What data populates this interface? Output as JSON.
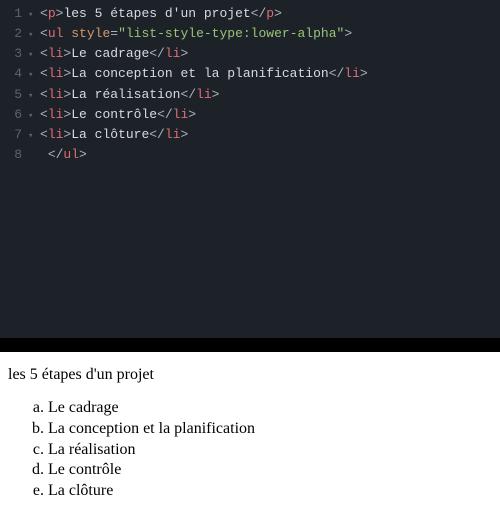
{
  "editor": {
    "lines": [
      {
        "num": "1",
        "fold": "▾",
        "tokens": [
          {
            "c": "tag-bracket",
            "t": "<"
          },
          {
            "c": "tag-name",
            "t": "p"
          },
          {
            "c": "tag-bracket",
            "t": ">"
          },
          {
            "c": "text",
            "t": "les 5 étapes d'un projet"
          },
          {
            "c": "tag-bracket",
            "t": "</"
          },
          {
            "c": "tag-name",
            "t": "p"
          },
          {
            "c": "tag-bracket",
            "t": ">"
          }
        ]
      },
      {
        "num": "2",
        "fold": "▾",
        "tokens": [
          {
            "c": "tag-bracket",
            "t": "<"
          },
          {
            "c": "tag-name",
            "t": "ul"
          },
          {
            "c": "text",
            "t": " "
          },
          {
            "c": "attr-name",
            "t": "style"
          },
          {
            "c": "attr-eq",
            "t": "="
          },
          {
            "c": "attr-value",
            "t": "\"list-style-type:lower-alpha\""
          },
          {
            "c": "tag-bracket",
            "t": ">"
          }
        ]
      },
      {
        "num": "3",
        "fold": "▾",
        "tokens": [
          {
            "c": "tag-bracket",
            "t": "<"
          },
          {
            "c": "tag-name",
            "t": "li"
          },
          {
            "c": "tag-bracket",
            "t": ">"
          },
          {
            "c": "text",
            "t": "Le cadrage"
          },
          {
            "c": "tag-bracket",
            "t": "</"
          },
          {
            "c": "tag-name",
            "t": "li"
          },
          {
            "c": "tag-bracket",
            "t": ">"
          }
        ]
      },
      {
        "num": "4",
        "fold": "▾",
        "tokens": [
          {
            "c": "tag-bracket",
            "t": "<"
          },
          {
            "c": "tag-name",
            "t": "li"
          },
          {
            "c": "tag-bracket",
            "t": ">"
          },
          {
            "c": "text",
            "t": "La conception et la planification"
          },
          {
            "c": "tag-bracket",
            "t": "</"
          },
          {
            "c": "tag-name",
            "t": "li"
          },
          {
            "c": "tag-bracket",
            "t": ">"
          }
        ]
      },
      {
        "num": "5",
        "fold": "▾",
        "tokens": [
          {
            "c": "tag-bracket",
            "t": "<"
          },
          {
            "c": "tag-name",
            "t": "li"
          },
          {
            "c": "tag-bracket",
            "t": ">"
          },
          {
            "c": "text",
            "t": "La réalisation"
          },
          {
            "c": "tag-bracket",
            "t": "</"
          },
          {
            "c": "tag-name",
            "t": "li"
          },
          {
            "c": "tag-bracket",
            "t": ">"
          }
        ]
      },
      {
        "num": "6",
        "fold": "▾",
        "tokens": [
          {
            "c": "tag-bracket",
            "t": "<"
          },
          {
            "c": "tag-name",
            "t": "li"
          },
          {
            "c": "tag-bracket",
            "t": ">"
          },
          {
            "c": "text",
            "t": "Le contrôle"
          },
          {
            "c": "tag-bracket",
            "t": "</"
          },
          {
            "c": "tag-name",
            "t": "li"
          },
          {
            "c": "tag-bracket",
            "t": ">"
          }
        ]
      },
      {
        "num": "7",
        "fold": "▾",
        "tokens": [
          {
            "c": "tag-bracket",
            "t": "<"
          },
          {
            "c": "tag-name",
            "t": "li"
          },
          {
            "c": "tag-bracket",
            "t": ">"
          },
          {
            "c": "text",
            "t": "La clôture"
          },
          {
            "c": "tag-bracket",
            "t": "</"
          },
          {
            "c": "tag-name",
            "t": "li"
          },
          {
            "c": "tag-bracket",
            "t": ">"
          }
        ]
      },
      {
        "num": "8",
        "fold": "",
        "tokens": [
          {
            "c": "text",
            "t": " "
          },
          {
            "c": "tag-bracket",
            "t": "</"
          },
          {
            "c": "tag-name",
            "t": "ul"
          },
          {
            "c": "tag-bracket",
            "t": ">"
          }
        ]
      }
    ]
  },
  "preview": {
    "heading": "les 5 étapes d'un projet",
    "items": [
      "Le cadrage",
      "La conception et la planification",
      "La réalisation",
      "Le contrôle",
      "La clôture"
    ]
  }
}
